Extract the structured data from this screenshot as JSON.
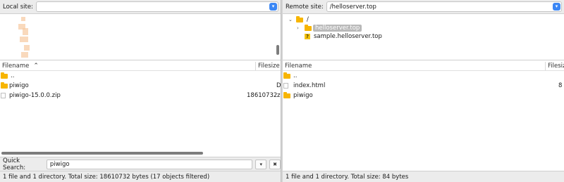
{
  "local": {
    "site_label": "Local site:",
    "site_value": "",
    "columns": {
      "filename": "Filename",
      "filesize": "Filesize",
      "sort_indicator": "^"
    },
    "rows": [
      {
        "name": "..",
        "type": "folder",
        "size": "",
        "extra": ""
      },
      {
        "name": "piwigo",
        "type": "folder",
        "size": "",
        "extra": "D"
      },
      {
        "name": "piwigo-15.0.0.zip",
        "type": "file",
        "size": "18610732",
        "extra": "z"
      }
    ],
    "quick_search": {
      "label": "Quick Search:",
      "value": "piwigo",
      "dropdown_glyph": "▾",
      "clear_glyph": "✖"
    },
    "status": "1 file and 1 directory. Total size: 18610732 bytes (17 objects filtered)"
  },
  "remote": {
    "site_label": "Remote site:",
    "site_value": "/helloserver.top",
    "tree": [
      {
        "name": "/",
        "icon": "folder-icon",
        "expander": "⌄"
      },
      {
        "name": "helloserver.top",
        "icon": "folder-icon",
        "expander": "›",
        "selected": true
      },
      {
        "name": "sample.helloserver.top",
        "icon": "unknown-icon",
        "expander": ""
      }
    ],
    "columns": {
      "filename": "Filename",
      "filesize": "Filesize"
    },
    "rows": [
      {
        "name": "..",
        "type": "folder",
        "size": ""
      },
      {
        "name": "index.html",
        "type": "file",
        "size": "8"
      },
      {
        "name": "piwigo",
        "type": "folder",
        "size": ""
      }
    ],
    "status": "1 file and 1 directory. Total size: 84 bytes"
  },
  "icons": {
    "dropdown": "chevron-down-icon",
    "question": "?"
  },
  "colors": {
    "folder": "#f7b500",
    "accent": "#3b87f5",
    "selection": "#b9b9b9"
  }
}
